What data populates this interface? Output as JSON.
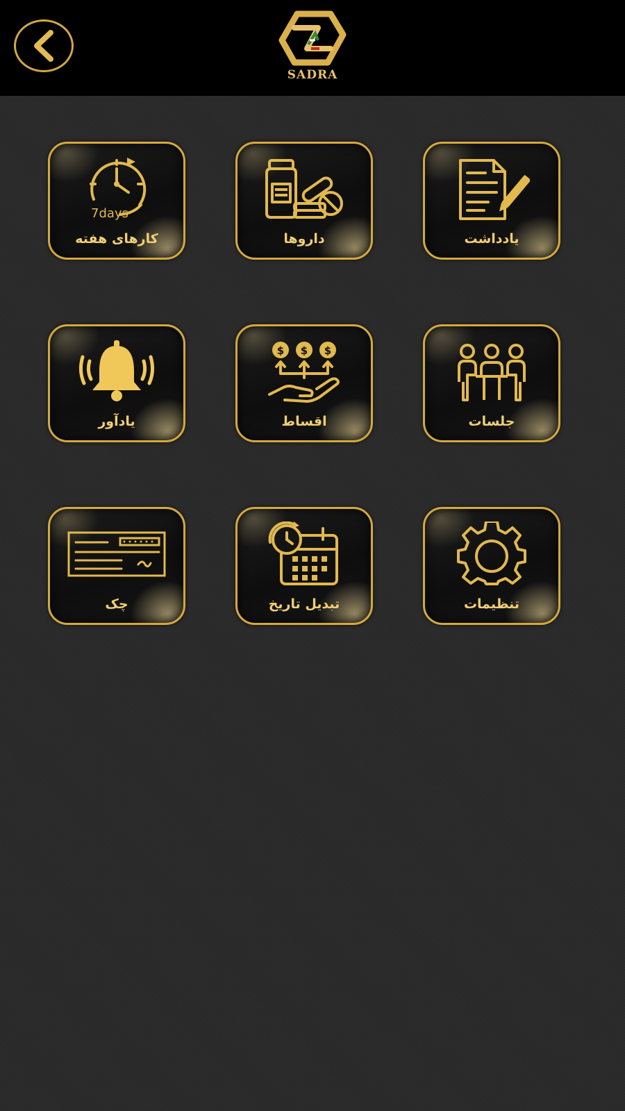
{
  "header": {
    "logo_text": "SADRA",
    "back_icon": "chevron-left-icon"
  },
  "colors": {
    "gold": "#d4a93c",
    "gold_light": "#f1cf73",
    "header_bg": "#000000",
    "page_bg": "#2a2a2a"
  },
  "tiles": [
    {
      "label": "کارهای هفته",
      "icon": "weekly-clock-icon",
      "icon_text": "7days"
    },
    {
      "label": "داروها",
      "icon": "medicine-icon"
    },
    {
      "label": "یادداشت",
      "icon": "note-icon"
    },
    {
      "label": "یادآور",
      "icon": "bell-icon"
    },
    {
      "label": "اقساط",
      "icon": "installments-icon"
    },
    {
      "label": "جلسات",
      "icon": "meeting-icon"
    },
    {
      "label": "چک",
      "icon": "cheque-icon"
    },
    {
      "label": "تبدیل تاریخ",
      "icon": "date-convert-icon"
    },
    {
      "label": "تنظیمات",
      "icon": "gear-icon"
    }
  ]
}
